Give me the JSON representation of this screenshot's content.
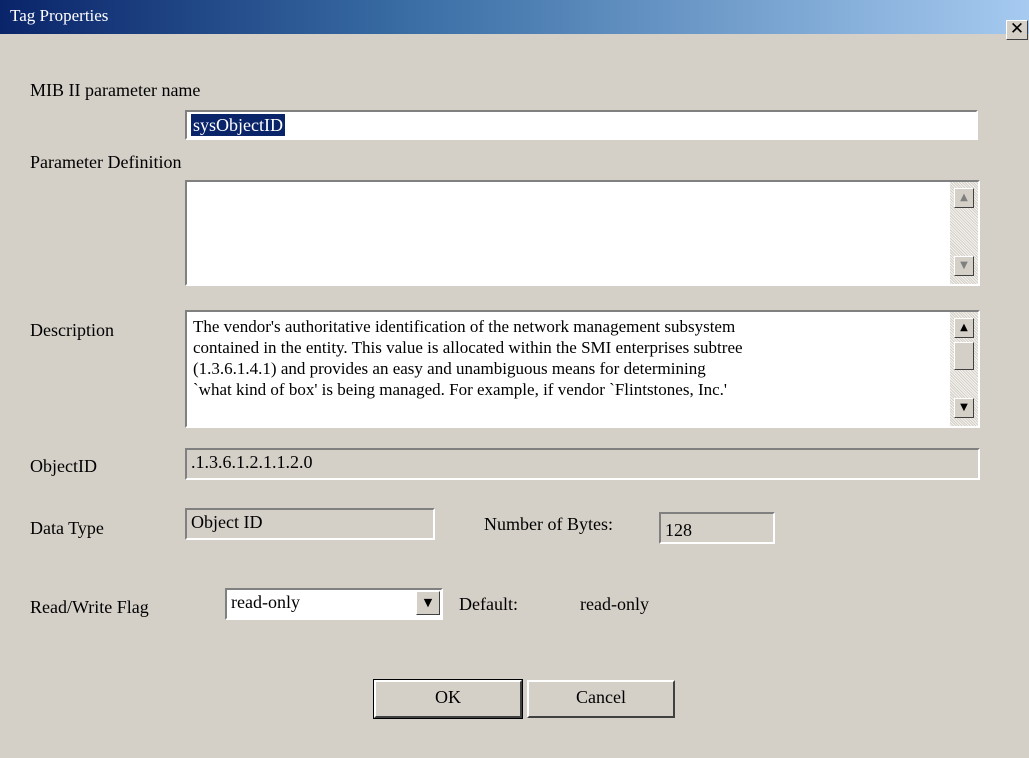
{
  "window": {
    "title": "Tag Properties",
    "close_glyph": "✕"
  },
  "mib_name": {
    "label": "MIB II parameter name",
    "value": "sysObjectID"
  },
  "param_def": {
    "label": "Parameter Definition",
    "value": ""
  },
  "description": {
    "label": "Description",
    "lines": [
      "The vendor's authoritative identification of the network management subsystem",
      "contained in the entity. This value is allocated within the SMI enterprises subtree",
      "(1.3.6.1.4.1) and provides an easy and unambiguous means for determining",
      "`what kind of box' is being managed.  For example, if vendor `Flintstones, Inc.'"
    ]
  },
  "object_id": {
    "label": "ObjectID",
    "value": ".1.3.6.1.2.1.1.2.0"
  },
  "data_type": {
    "label": "Data Type",
    "value": "Object ID"
  },
  "num_bytes": {
    "label": "Number of Bytes:",
    "value": "128"
  },
  "rw_flag": {
    "label": "Read/Write Flag",
    "selected": "read-only",
    "default_label": "Default:",
    "default_value": "read-only"
  },
  "buttons": {
    "ok": "OK",
    "cancel": "Cancel"
  },
  "icons": {
    "close": "close-icon",
    "up": "scroll-up-arrow-icon",
    "down": "scroll-down-arrow-icon",
    "dropdown": "chevron-down-icon"
  },
  "colors": {
    "dialog_bg": "#d4d0c8",
    "titlebar_start": "#0a246a",
    "titlebar_end": "#a6caf0",
    "selection": "#0a246a"
  }
}
